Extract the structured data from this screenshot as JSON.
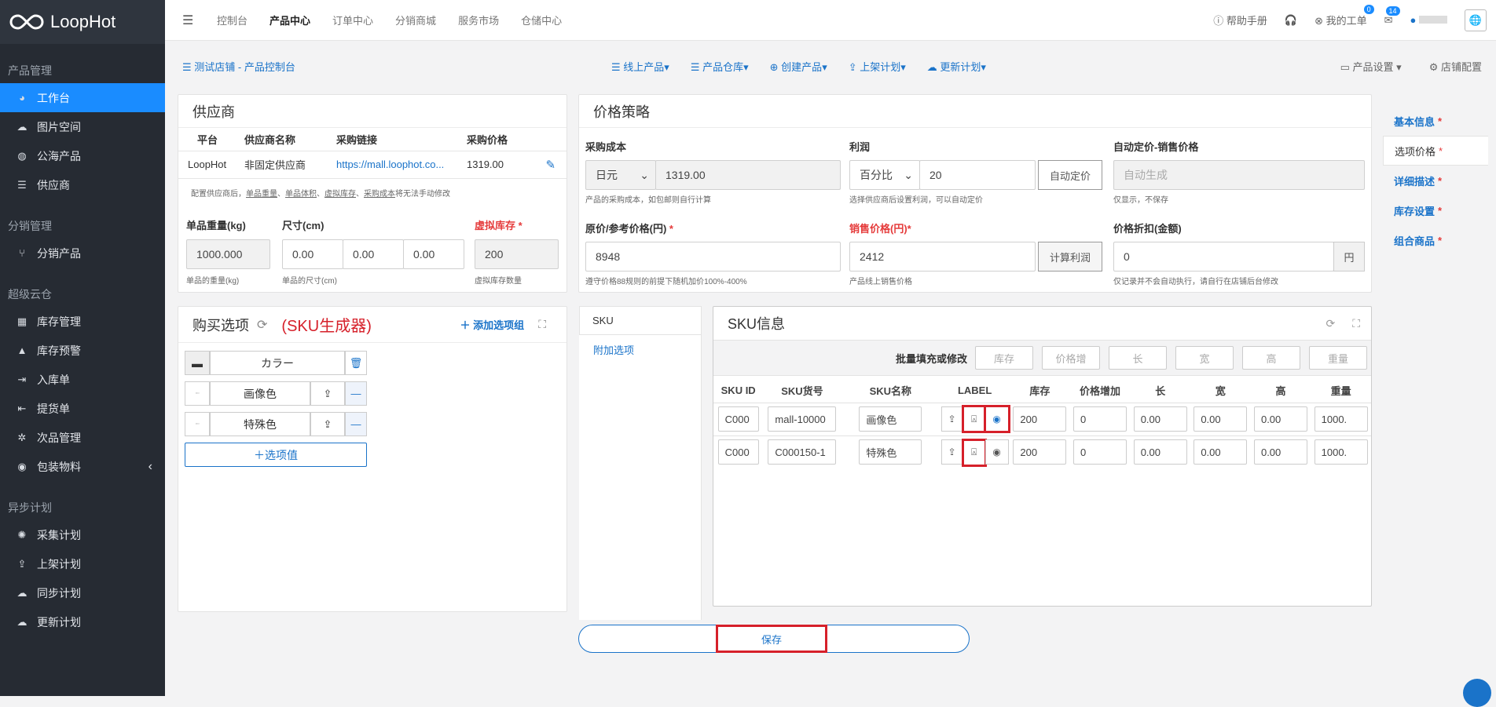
{
  "app": {
    "logo": "LoopHot"
  },
  "sidebar": {
    "groups": [
      {
        "title": "产品管理",
        "items": [
          {
            "label": "工作台",
            "icon": "dashboard-icon",
            "active": true
          },
          {
            "label": "图片空间",
            "icon": "cloud-icon"
          },
          {
            "label": "公海产品",
            "icon": "globe-icon"
          },
          {
            "label": "供应商",
            "icon": "list-icon"
          }
        ]
      },
      {
        "title": "分销管理",
        "items": [
          {
            "label": "分销产品",
            "icon": "branch-icon"
          }
        ]
      },
      {
        "title": "超级云仓",
        "items": [
          {
            "label": "库存管理",
            "icon": "warehouse-icon"
          },
          {
            "label": "库存预警",
            "icon": "warning-icon"
          },
          {
            "label": "入库单",
            "icon": "signin-icon"
          },
          {
            "label": "提货单",
            "icon": "signout-icon"
          },
          {
            "label": "次品管理",
            "icon": "gear-icon"
          },
          {
            "label": "包装物料",
            "icon": "search-icon",
            "arrow": "‹"
          }
        ]
      },
      {
        "title": "异步计划",
        "items": [
          {
            "label": "采集计划",
            "icon": "bug-icon"
          },
          {
            "label": "上架计划",
            "icon": "upload-icon"
          },
          {
            "label": "同步计划",
            "icon": "cloud-sync-icon"
          },
          {
            "label": "更新计划",
            "icon": "cloud-upload-icon"
          }
        ]
      }
    ]
  },
  "topnav": {
    "items": [
      "控制台",
      "产品中心",
      "订单中心",
      "分销商城",
      "服务市场",
      "仓储中心"
    ],
    "current": "产品中心",
    "help": "帮助手册",
    "ticket": "我的工单",
    "ticket_badge": "0",
    "msg_badge": "14"
  },
  "toolbar": {
    "crumb": "测试店铺 - 产品控制台",
    "menus": [
      "线上产品",
      "产品仓库",
      "创建产品",
      "上架计划",
      "更新计划"
    ],
    "right": [
      "产品设置",
      "店铺配置"
    ]
  },
  "supplier": {
    "title": "供应商",
    "headers": [
      "平台",
      "供应商名称",
      "采购链接",
      "采购价格"
    ],
    "row": [
      "LoopHot",
      "非固定供应商",
      "https://mall.loophot.co...",
      "1319.00"
    ],
    "note_pre": "配置供应商后，",
    "note_links": [
      "单品重量",
      "单品体积",
      "虚拟库存",
      "采购成本"
    ],
    "note_post": "将无法手动修改",
    "weight_label": "单品重量(kg)",
    "weight": "1000.000",
    "weight_hint": "单品的重量(kg)",
    "size_label": "尺寸(cm)",
    "size": [
      "0.00",
      "0.00",
      "0.00"
    ],
    "size_hint": "单品的尺寸(cm)",
    "stock_label": "虚拟库存",
    "stock": "200",
    "stock_hint": "虚拟库存数量"
  },
  "price": {
    "title": "价格策略",
    "cost_label": "采购成本",
    "currency": "日元",
    "cost": "1319.00",
    "cost_hint": "产品的采购成本，如包邮则自行计算",
    "profit_label": "利润",
    "profit_mode": "百分比",
    "profit": "20",
    "auto_btn": "自动定价",
    "profit_hint": "选择供应商后设置利润，可以自动定价",
    "auto_label": "自动定价-销售价格",
    "auto_placeholder": "自动生成",
    "auto_hint": "仅显示，不保存",
    "orig_label": "原价/参考价格(円)",
    "orig": "8948",
    "orig_hint": "遵守价格88规则的前提下随机加价100%-400%",
    "sale_label": "销售价格(円)",
    "sale": "2412",
    "calc_btn": "计算利润",
    "sale_hint": "产品线上销售价格",
    "disc_label": "价格折扣(金额)",
    "disc": "0",
    "disc_unit": "円",
    "disc_hint": "仅记录并不会自动执行，请自行在店铺后台修改"
  },
  "options": {
    "title": "购买选项",
    "sku_gen": "(SKU生成器)",
    "add_group": "添加选项组",
    "group_name": "カラー",
    "values": [
      "画像色",
      "特殊色"
    ],
    "add_value": "选项值"
  },
  "tabs": {
    "items": [
      "SKU",
      "附加选项"
    ]
  },
  "sku": {
    "title": "SKU信息",
    "bulk_label": "批量填充或修改",
    "bulk": [
      "库存",
      "价格增",
      "长",
      "宽",
      "高",
      "重量"
    ],
    "headers": [
      "SKU ID",
      "SKU货号",
      "SKU名称",
      "LABEL",
      "库存",
      "价格增加",
      "长",
      "宽",
      "高",
      "重量"
    ],
    "rows": [
      {
        "id": "C000",
        "code": "mall-10000",
        "name": "画像色",
        "stock": "200",
        "price": "0",
        "l": "0.00",
        "w": "0.00",
        "h": "0.00",
        "weight": "1000."
      },
      {
        "id": "C000",
        "code": "C000150-1",
        "name": "特殊色",
        "stock": "200",
        "price": "0",
        "l": "0.00",
        "w": "0.00",
        "h": "0.00",
        "weight": "1000."
      }
    ]
  },
  "save": "保存",
  "rightnav": {
    "items": [
      "基本信息",
      "选项价格",
      "详细描述",
      "库存设置",
      "组合商品"
    ],
    "current": "选项价格"
  }
}
